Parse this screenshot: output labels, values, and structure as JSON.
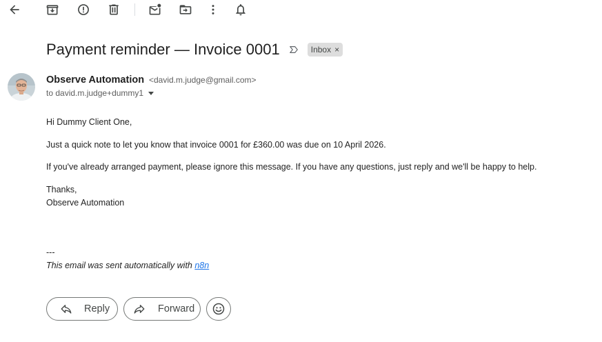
{
  "toolbar": {
    "buttons": [
      {
        "name": "back",
        "icon": "arrow-left-icon"
      },
      {
        "name": "archive",
        "icon": "archive-icon"
      },
      {
        "name": "report-spam",
        "icon": "report-icon"
      },
      {
        "name": "delete",
        "icon": "trash-icon"
      },
      {
        "name": "mark-unread",
        "icon": "mark-unread-icon"
      },
      {
        "name": "move-to",
        "icon": "move-to-icon"
      },
      {
        "name": "more",
        "icon": "more-vert-icon"
      },
      {
        "name": "snooze",
        "icon": "bell-icon"
      }
    ]
  },
  "email": {
    "subject": "Payment reminder — Invoice 0001",
    "label": "Inbox",
    "label_close": "×",
    "sender_name": "Observe Automation",
    "sender_email": "<david.m.judge@gmail.com>",
    "recipient": "to david.m.judge+dummy1",
    "body": {
      "greeting": "Hi Dummy Client One,",
      "line1": "Just a quick note to let you know that invoice 0001 for £360.00 was due on 10 April 2026.",
      "line2": "If you've already arranged payment, please ignore this message. If you have any questions, just reply and we'll be happy to help.",
      "signoff": "Thanks,",
      "signature": "Observe Automation",
      "separator": "---",
      "footer_text": "This email was sent automatically with ",
      "footer_link": "n8n"
    }
  },
  "actions": {
    "reply": "Reply",
    "forward": "Forward"
  },
  "colors": {
    "link": "#1a73e8",
    "chip_bg": "#dddddd",
    "icon": "#444746"
  }
}
